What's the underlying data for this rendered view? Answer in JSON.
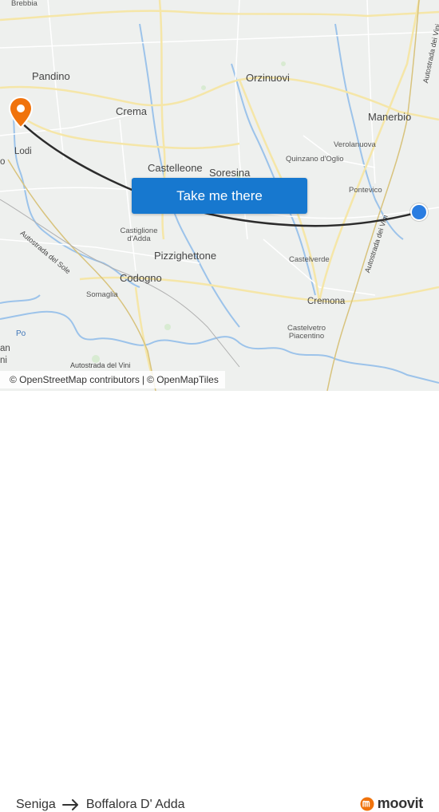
{
  "map": {
    "places": [
      {
        "name": "Pandino",
        "size": "big"
      },
      {
        "name": "Crema",
        "size": "big"
      },
      {
        "name": "Orzinuovi",
        "size": "big"
      },
      {
        "name": "Manerbio",
        "size": "big"
      },
      {
        "name": "Lodi",
        "size": "mid"
      },
      {
        "name": "Castelleone",
        "size": "big"
      },
      {
        "name": "Soresina",
        "size": "big"
      },
      {
        "name": "Verolanuova",
        "size": "small"
      },
      {
        "name": "Quinzano d'Oglio",
        "size": "small"
      },
      {
        "name": "Pontevico",
        "size": "small"
      },
      {
        "name": "Castiglione d'Adda",
        "size": "small"
      },
      {
        "name": "Pizzighettone",
        "size": "big"
      },
      {
        "name": "Codogno",
        "size": "big"
      },
      {
        "name": "Castelverde",
        "size": "small"
      },
      {
        "name": "Somaglia",
        "size": "small"
      },
      {
        "name": "Cremona",
        "size": "mid"
      },
      {
        "name": "Castelvetro Piacentino",
        "size": "small"
      },
      {
        "name": "Brebbia",
        "size": "small"
      },
      {
        "name": "an",
        "size": "mid"
      },
      {
        "name": "ni",
        "size": "mid"
      },
      {
        "name": "o",
        "size": "mid"
      }
    ],
    "roads": [
      {
        "name": "Autostrada del Sole"
      },
      {
        "name": "Autostrada dei Vini"
      },
      {
        "name": "Autostrada dei Vini"
      },
      {
        "name": "Autostrada del Vini"
      }
    ],
    "water": [
      {
        "name": "Po"
      }
    ],
    "colors": {
      "route": "#2c2c2c",
      "origin": "#2a7de1",
      "destination": "#f0730c",
      "button": "#1778cf",
      "brand_accent": "#f0730c"
    },
    "origin_icon": "origin-dot-icon",
    "destination_icon": "destination-pin-icon"
  },
  "cta": {
    "label": "Take me there"
  },
  "attribution": {
    "osm": "© OpenStreetMap contributors",
    "separator": "|",
    "omt": "© OpenMapTiles"
  },
  "footer": {
    "origin": "Seniga",
    "destination": "Boffalora D' Adda",
    "arrow_icon": "arrow-right-icon",
    "brand": "moovit",
    "brand_icon": "moovit-logo-icon"
  }
}
